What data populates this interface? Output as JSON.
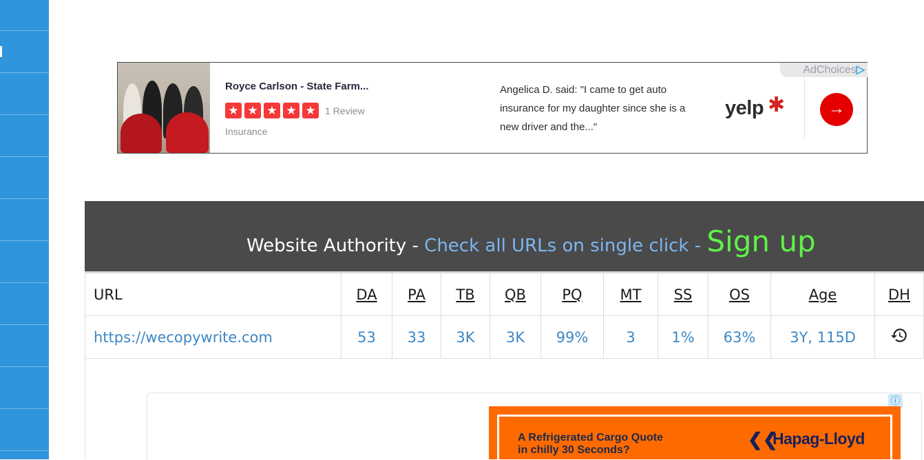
{
  "ad": {
    "business_name": "Royce Carlson - State Farm...",
    "stars": [
      "★",
      "★",
      "★",
      "★",
      "★"
    ],
    "review_count": "1 Review",
    "category": "Insurance",
    "quote": "Angelica D. said: \"I came to get auto insurance for my daughter since she is a new driver and the...\"",
    "brand_label": "yelp",
    "brand_burst": "✱",
    "go_icon": "→",
    "adchoices": "AdChoices",
    "adchoices_icon": "▷",
    "brand_color": "#d32323"
  },
  "authority": {
    "title_prefix": "Website Authority - ",
    "title_link": "Check all URLs on single click - ",
    "signup": "Sign up",
    "columns": [
      "URL",
      "DA",
      "PA",
      "TB",
      "QB",
      "PQ",
      "MT",
      "SS",
      "OS",
      "Age",
      "DH"
    ],
    "row": {
      "url": "https://wecopywrite.com",
      "da": "53",
      "pa": "33",
      "tb": "3K",
      "qb": "3K",
      "pq": "99%",
      "mt": "3",
      "ss": "1%",
      "os": "63%",
      "age": "3Y, 115D",
      "dh_icon": "history-icon"
    }
  },
  "ad2": {
    "info_icon": "ⓘ",
    "headline_line1": "A Refrigerated Cargo Quote",
    "headline_line2": "in chilly 30 Seconds?",
    "logo": "Hapag-Lloyd",
    "logo_mark": "❮❮",
    "accent_color": "#ff6a00"
  },
  "sidebar": {
    "accent_color": "#2f95dc"
  }
}
